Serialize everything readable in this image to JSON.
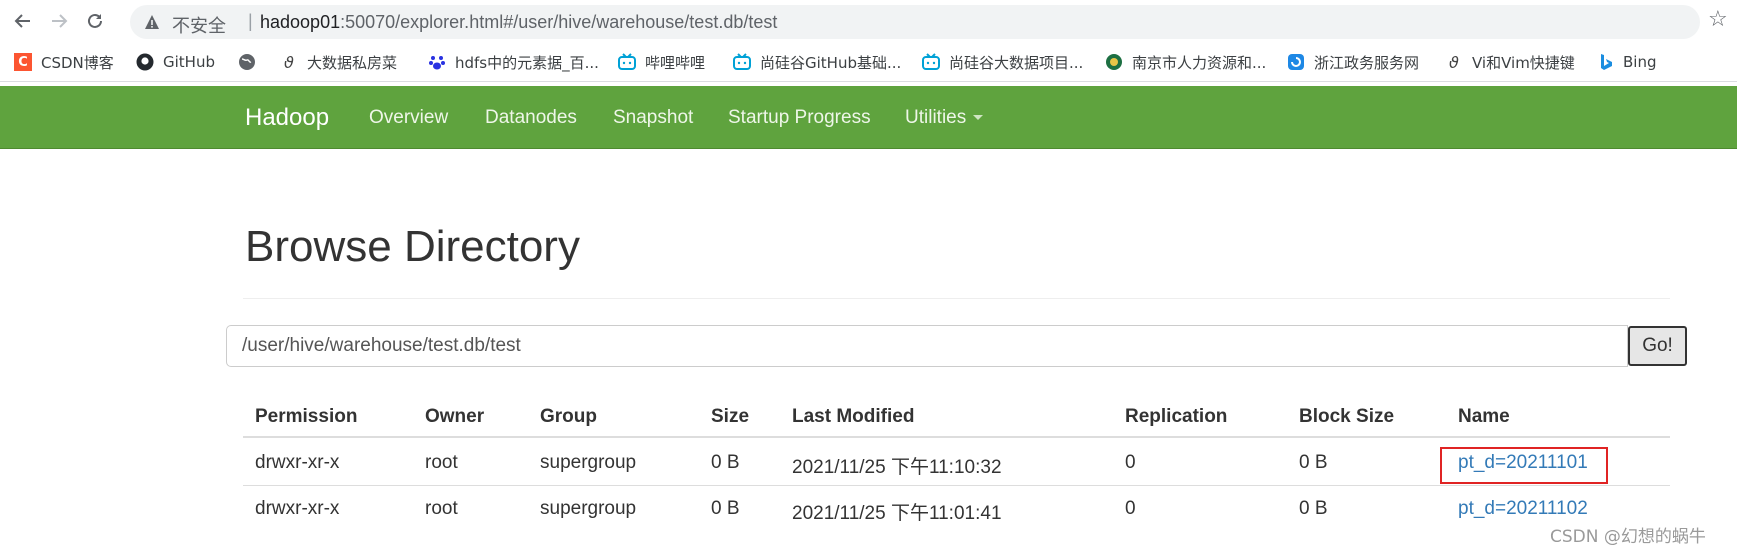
{
  "browser": {
    "insecure_label": "不安全",
    "url_host": "hadoop01",
    "url_rest": ":50070/explorer.html#/user/hive/warehouse/test.db/test"
  },
  "bookmarks": [
    {
      "label": "CSDN博客",
      "icon": "csdn-icon"
    },
    {
      "label": "GitHub",
      "icon": "github-icon"
    },
    {
      "label": "",
      "icon": "globe-icon"
    },
    {
      "label": "大数据私房菜",
      "icon": "vi-icon"
    },
    {
      "label": "hdfs中的元素据_百...",
      "icon": "baidu-icon"
    },
    {
      "label": "哔哩哔哩",
      "icon": "bilibili-icon"
    },
    {
      "label": "尚硅谷GitHub基础...",
      "icon": "bilibili-icon"
    },
    {
      "label": "尚硅谷大数据项目...",
      "icon": "bilibili-icon"
    },
    {
      "label": "南京市人力资源和...",
      "icon": "gov-icon"
    },
    {
      "label": "浙江政务服务网",
      "icon": "zj-icon"
    },
    {
      "label": "Vi和Vim快捷键",
      "icon": "vi-icon"
    },
    {
      "label": "Bing",
      "icon": "bing-icon"
    }
  ],
  "navbar": {
    "brand": "Hadoop",
    "links": [
      "Overview",
      "Datanodes",
      "Snapshot",
      "Startup Progress",
      "Utilities"
    ]
  },
  "page": {
    "title": "Browse Directory",
    "path_value": "/user/hive/warehouse/test.db/test",
    "go_label": "Go!"
  },
  "table": {
    "headers": [
      "Permission",
      "Owner",
      "Group",
      "Size",
      "Last Modified",
      "Replication",
      "Block Size",
      "Name"
    ],
    "rows": [
      [
        "drwxr-xr-x",
        "root",
        "supergroup",
        "0 B",
        "2021/11/25 下午11:10:32",
        "0",
        "0 B",
        "pt_d=20211101"
      ],
      [
        "drwxr-xr-x",
        "root",
        "supergroup",
        "0 B",
        "2021/11/25 下午11:01:41",
        "0",
        "0 B",
        "pt_d=20211102"
      ]
    ]
  },
  "colors": {
    "navbar_bg": "#5fa33e",
    "link": "#337ab7",
    "highlight": "#e02424"
  },
  "watermark": "CSDN @幻想的蜗牛"
}
